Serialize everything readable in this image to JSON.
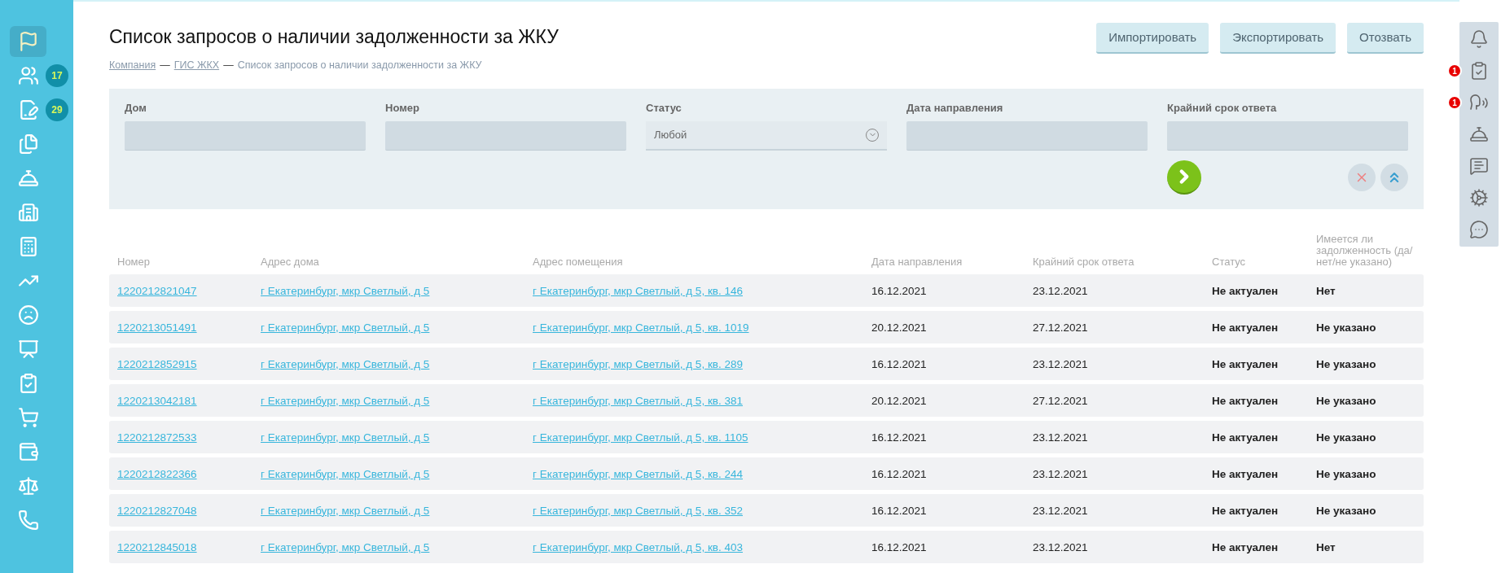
{
  "sidebar": {
    "items": [
      {
        "selected": true
      },
      {
        "selected": false,
        "badge": "17"
      },
      {
        "selected": false,
        "badge": "29"
      },
      {
        "selected": false
      },
      {
        "selected": false
      },
      {
        "selected": false
      },
      {
        "selected": false
      },
      {
        "selected": false
      },
      {
        "selected": false
      },
      {
        "selected": false
      },
      {
        "selected": false
      },
      {
        "selected": false
      },
      {
        "selected": false
      },
      {
        "selected": false
      },
      {
        "selected": false
      }
    ]
  },
  "header": {
    "title": "Список запросов о наличии задолженности за ЖКУ",
    "breadcrumbs": [
      {
        "label": "Компания",
        "link": true
      },
      {
        "label": "ГИС ЖКХ",
        "link": true
      },
      {
        "label": "Список запросов о наличии задолженности за ЖКУ",
        "link": false
      }
    ],
    "separator": "—",
    "buttons": [
      "Импортировать",
      "Экспортировать",
      "Отозвать"
    ]
  },
  "filters": [
    {
      "label": "Дом",
      "kind": "text"
    },
    {
      "label": "Номер",
      "kind": "text"
    },
    {
      "label": "Статус",
      "kind": "select",
      "value": "Любой"
    },
    {
      "label": "Дата направления",
      "kind": "text"
    },
    {
      "label": "Крайний срок ответа",
      "kind": "text"
    }
  ],
  "table": {
    "columns": [
      "Номер",
      "Адрес дома",
      "Адрес помещения",
      "Дата направления",
      "Крайний срок ответа",
      "Статус",
      "Имеется ли задолженность (да/нет/не указано)"
    ],
    "rows": [
      [
        "1220212821047",
        "г Екатеринбург, мкр Светлый, д 5",
        "г Екатеринбург, мкр Светлый, д 5, кв. 146",
        "16.12.2021",
        "23.12.2021",
        "Не актуален",
        "Нет"
      ],
      [
        "1220213051491",
        "г Екатеринбург, мкр Светлый, д 5",
        "г Екатеринбург, мкр Светлый, д 5, кв. 1019",
        "20.12.2021",
        "27.12.2021",
        "Не актуален",
        "Не указано"
      ],
      [
        "1220212852915",
        "г Екатеринбург, мкр Светлый, д 5",
        "г Екатеринбург, мкр Светлый, д 5, кв. 289",
        "16.12.2021",
        "23.12.2021",
        "Не актуален",
        "Не указано"
      ],
      [
        "1220213042181",
        "г Екатеринбург, мкр Светлый, д 5",
        "г Екатеринбург, мкр Светлый, д 5, кв. 381",
        "20.12.2021",
        "27.12.2021",
        "Не актуален",
        "Не указано"
      ],
      [
        "1220212872533",
        "г Екатеринбург, мкр Светлый, д 5",
        "г Екатеринбург, мкр Светлый, д 5, кв. 1105",
        "16.12.2021",
        "23.12.2021",
        "Не актуален",
        "Не указано"
      ],
      [
        "1220212822366",
        "г Екатеринбург, мкр Светлый, д 5",
        "г Екатеринбург, мкр Светлый, д 5, кв. 244",
        "16.12.2021",
        "23.12.2021",
        "Не актуален",
        "Не указано"
      ],
      [
        "1220212827048",
        "г Екатеринбург, мкр Светлый, д 5",
        "г Екатеринбург, мкр Светлый, д 5, кв. 352",
        "16.12.2021",
        "23.12.2021",
        "Не актуален",
        "Не указано"
      ],
      [
        "1220212845018",
        "г Екатеринбург, мкр Светлый, д 5",
        "г Екатеринбург, мкр Светлый, д 5, кв. 403",
        "16.12.2021",
        "23.12.2021",
        "Не актуален",
        "Нет"
      ]
    ]
  },
  "right_toolbar": {
    "items": [
      {
        "kind": "notifications"
      },
      {
        "kind": "tasks",
        "badge": "1"
      },
      {
        "kind": "appeals",
        "badge": "1"
      },
      {
        "kind": "reception"
      },
      {
        "kind": "messages"
      },
      {
        "kind": "settings"
      },
      {
        "kind": "chat"
      }
    ]
  }
}
